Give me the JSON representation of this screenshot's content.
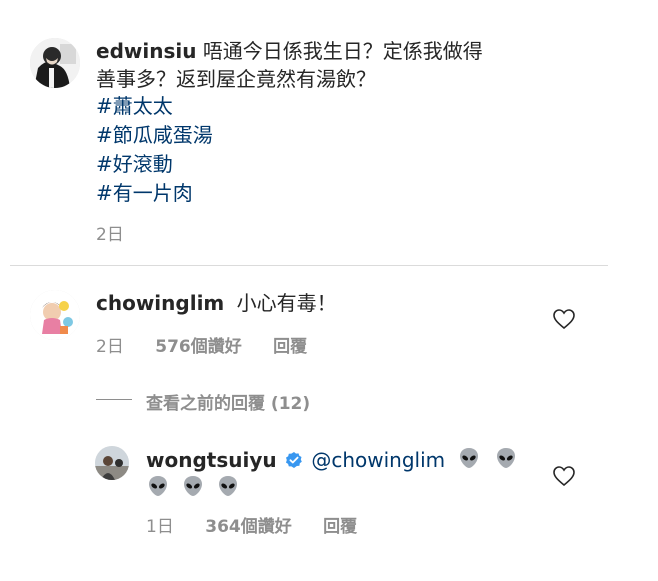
{
  "caption": {
    "username": "edwinsiu",
    "line1": "唔通今日係我生日？定係我做得",
    "line2": "善事多？返到屋企竟然有湯飲？",
    "hashtags": [
      "#蕭太太",
      "#節瓜咸蛋湯",
      "#好滾動",
      "#有一片肉"
    ],
    "time": "2日"
  },
  "comment1": {
    "username": "chowinglim",
    "text": "小心有毒！",
    "time": "2日",
    "likes": "576個讚好",
    "reply": "回覆"
  },
  "view_replies": "查看之前的回覆 (12)",
  "reply1": {
    "username": "wongtsuiyu",
    "verified": "verified-badge-icon",
    "mention": "@chowinglim",
    "emoji": "alien-emoji",
    "time": "1日",
    "likes": "364個讚好",
    "reply": "回覆"
  },
  "colors": {
    "text": "#262626",
    "link": "#00376b",
    "meta": "#8e8e8e",
    "verified": "#3897f0",
    "divider": "#dbdbdb"
  }
}
